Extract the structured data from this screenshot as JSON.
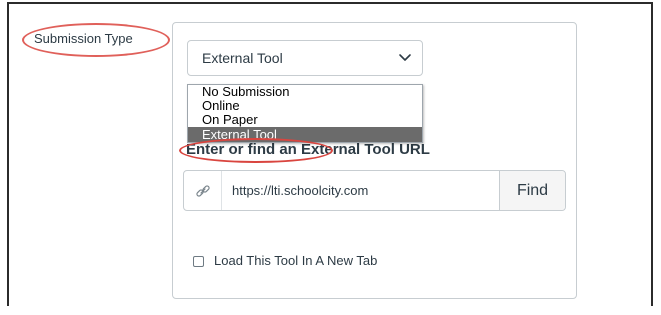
{
  "submission_type": {
    "label": "Submission Type",
    "selected_value": "External Tool",
    "options": [
      {
        "label": "No Submission",
        "selected": false
      },
      {
        "label": "Online",
        "selected": false
      },
      {
        "label": "On Paper",
        "selected": false
      },
      {
        "label": "External Tool",
        "selected": true
      }
    ]
  },
  "section": {
    "title": "Enter or find an External Tool URL"
  },
  "url": {
    "icon": "link-icon",
    "value": "https://lti.schoolcity.com",
    "find_label": "Find"
  },
  "new_tab": {
    "label": "Load This Tool In A New Tab",
    "checked": false
  },
  "annotation_color": "#d9453f"
}
